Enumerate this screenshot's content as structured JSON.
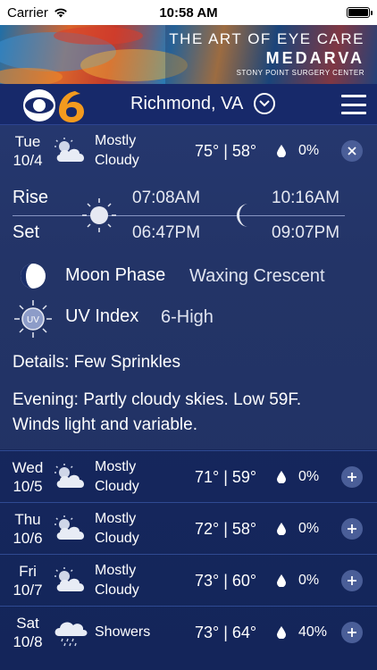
{
  "status_bar": {
    "carrier": "Carrier",
    "time": "10:58 AM"
  },
  "ad": {
    "line1": "THE ART OF EYE CARE",
    "line2": "MEDARVA",
    "line3": "STONY POINT SURGERY CENTER"
  },
  "header": {
    "location": "Richmond, VA"
  },
  "selected_day": {
    "day": "Tue",
    "date": "10/4",
    "condition_line1": "Mostly",
    "condition_line2": "Cloudy",
    "temps": "75° | 58°",
    "precip": "0%",
    "icon": "partly-cloudy-icon"
  },
  "details": {
    "rise_label": "Rise",
    "set_label": "Set",
    "sunrise": "07:08AM",
    "sunset": "06:47PM",
    "moonrise": "10:16AM",
    "moonset": "09:07PM",
    "moon_phase_label": "Moon Phase",
    "moon_phase_value": "Waxing Crescent",
    "uv_label": "UV Index",
    "uv_value": "6-High",
    "uv_icon_text": "UV",
    "details_text": "Details: Few Sprinkles",
    "evening_line1": "Evening: Partly cloudy skies. Low 59F.",
    "evening_line2": "Winds light and variable."
  },
  "forecast": [
    {
      "day": "Wed",
      "date": "10/5",
      "condition_line1": "Mostly",
      "condition_line2": "Cloudy",
      "temps": "71° | 59°",
      "precip": "0%",
      "icon": "partly-cloudy-icon"
    },
    {
      "day": "Thu",
      "date": "10/6",
      "condition_line1": "Mostly",
      "condition_line2": "Cloudy",
      "temps": "72° | 58°",
      "precip": "0%",
      "icon": "partly-cloudy-icon"
    },
    {
      "day": "Fri",
      "date": "10/7",
      "condition_line1": "Mostly",
      "condition_line2": "Cloudy",
      "temps": "73° | 60°",
      "precip": "0%",
      "icon": "partly-cloudy-icon"
    },
    {
      "day": "Sat",
      "date": "10/8",
      "condition_line1": "Showers",
      "condition_line2": "",
      "temps": "73° | 64°",
      "precip": "40%",
      "icon": "showers-icon"
    }
  ],
  "colors": {
    "background": "#16285e",
    "row_button": "#4a5e98",
    "brand_orange": "#f39a1e"
  }
}
